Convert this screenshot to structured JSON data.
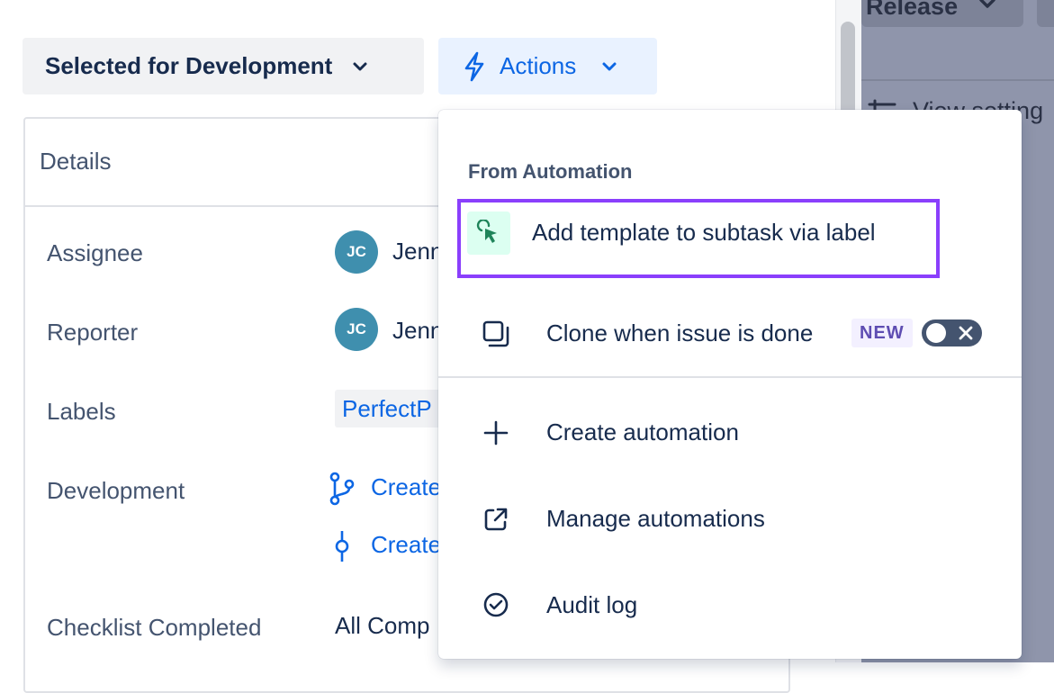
{
  "colors": {
    "primary": "#0c66e4",
    "highlight": "#8a3ffc",
    "text": "#172b4d",
    "subtle_text": "#44546f",
    "avatar": "#3f8fae"
  },
  "background_panel": {
    "release_label": "Release",
    "view_settings_label": "View setting"
  },
  "header": {
    "status_label": "Selected for Development",
    "actions_label": "Actions"
  },
  "details": {
    "heading": "Details",
    "fields": {
      "assignee": {
        "label": "Assignee",
        "avatar_initials": "JC",
        "value": "Jenn"
      },
      "reporter": {
        "label": "Reporter",
        "avatar_initials": "JC",
        "value": "Jenn"
      },
      "labels": {
        "label": "Labels",
        "value": "PerfectP"
      },
      "development": {
        "label": "Development",
        "link_branch": "Create",
        "link_commit": "Create"
      },
      "checklist": {
        "label": "Checklist Completed",
        "value": "All Comp"
      }
    }
  },
  "actions_menu": {
    "section_title": "From Automation",
    "items": [
      {
        "label": "Add template to subtask via label",
        "icon": "automation-cursor-icon",
        "highlighted": true
      },
      {
        "label": "Clone when issue is done",
        "icon": "clone-icon",
        "badge": "NEW",
        "toggle": "off"
      },
      {
        "label": "Create automation",
        "icon": "plus-icon"
      },
      {
        "label": "Manage automations",
        "icon": "external-link-icon"
      },
      {
        "label": "Audit log",
        "icon": "check-circle-icon"
      }
    ]
  }
}
